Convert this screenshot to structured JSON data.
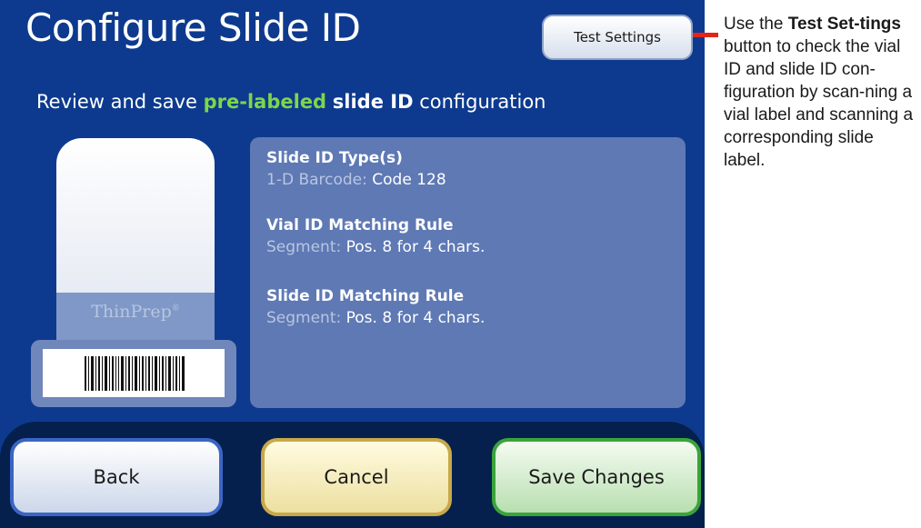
{
  "screen": {
    "title": "Configure Slide ID",
    "test_settings_label": "Test Settings",
    "subtitle": {
      "part1": "Review and save ",
      "highlight": "pre-labeled",
      "part2": " ",
      "bold": "slide ID",
      "part3": " configuration"
    },
    "slide": {
      "brand": "ThinPrep",
      "brand_mark": "®"
    },
    "info": {
      "type_heading": "Slide ID Type(s)",
      "type_label": "1-D Barcode: ",
      "type_value": "Code 128",
      "vial_heading": "Vial ID Matching Rule",
      "vial_label": "Segment: ",
      "vial_value": "Pos. 8 for 4 chars.",
      "slide_heading": "Slide ID Matching Rule",
      "slide_label": "Segment: ",
      "slide_value": "Pos. 8 for 4 chars."
    },
    "buttons": {
      "back": "Back",
      "cancel": "Cancel",
      "save": "Save Changes"
    }
  },
  "callout": {
    "prefix": "Use the ",
    "bold": "Test Set-tings",
    "suffix": " button to check the vial ID and slide ID con-figuration by scan-ning a vial label and scanning a corresponding slide label."
  },
  "colors": {
    "background": "#0d3a8e",
    "highlight_green": "#7cd64a",
    "callout_line": "#e52319"
  }
}
